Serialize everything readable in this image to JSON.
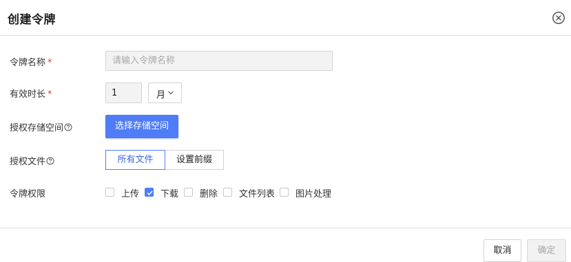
{
  "dialog": {
    "title": "创建令牌",
    "close_icon": "close-circle-icon"
  },
  "form": {
    "token_name": {
      "label": "令牌名称",
      "required_mark": "*",
      "placeholder": "请输入令牌名称",
      "value": ""
    },
    "duration": {
      "label": "有效时长",
      "required_mark": "*",
      "value": "1",
      "unit_selected": "月",
      "unit_icon": "chevron-down-icon"
    },
    "storage": {
      "label": "授权存储空间",
      "help_icon": "question-circle-icon",
      "button_label": "选择存储空间"
    },
    "files": {
      "label": "授权文件",
      "help_icon": "question-circle-icon",
      "options": [
        {
          "label": "所有文件",
          "active": true
        },
        {
          "label": "设置前缀",
          "active": false
        }
      ]
    },
    "permissions": {
      "label": "令牌权限",
      "options": [
        {
          "label": "上传",
          "checked": false
        },
        {
          "label": "下载",
          "checked": true
        },
        {
          "label": "删除",
          "checked": false
        },
        {
          "label": "文件列表",
          "checked": false
        },
        {
          "label": "图片处理",
          "checked": false
        }
      ]
    }
  },
  "footer": {
    "cancel_label": "取消",
    "ok_label": "确定"
  },
  "colors": {
    "accent": "#4f7cf7",
    "required": "#e0393e",
    "disabled_text": "#a8a8a8"
  }
}
